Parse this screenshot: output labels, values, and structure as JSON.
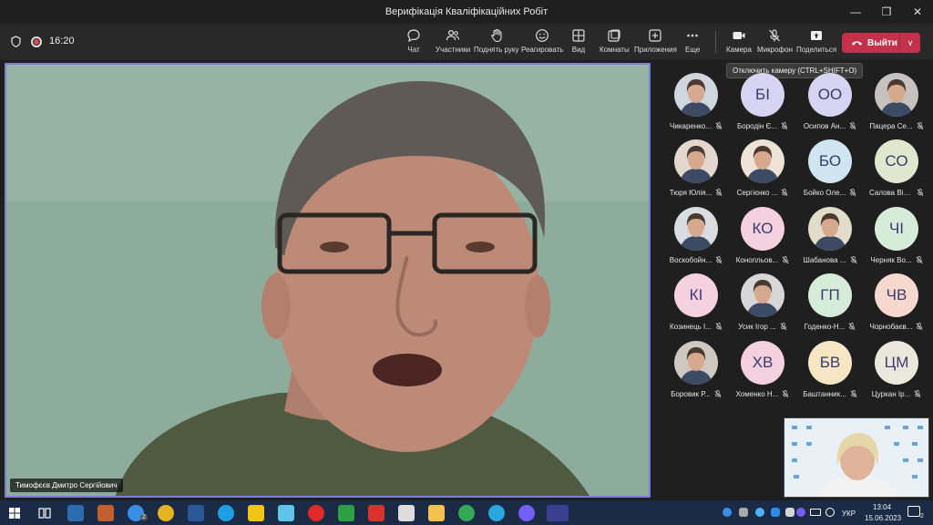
{
  "window": {
    "title": "Верифікація Кваліфікаційних Робіт"
  },
  "toolbar": {
    "timer": "16:20",
    "items": [
      {
        "label": "Чат",
        "icon": "chat-icon"
      },
      {
        "label": "Участники",
        "icon": "people-icon"
      },
      {
        "label": "Поднять руку",
        "icon": "raise-hand-icon"
      },
      {
        "label": "Реагировать",
        "icon": "smiley-icon"
      },
      {
        "label": "Вид",
        "icon": "grid-view-icon"
      },
      {
        "label": "Комнаты",
        "icon": "rooms-icon"
      },
      {
        "label": "Приложения",
        "icon": "plus-apps-icon"
      },
      {
        "label": "Еще",
        "icon": "more-icon"
      },
      {
        "label": "Камера",
        "icon": "camera-icon"
      },
      {
        "label": "Микрофон",
        "icon": "mic-off-icon"
      },
      {
        "label": "Поделиться",
        "icon": "share-icon"
      }
    ],
    "leave_label": "Выйти"
  },
  "tooltip": "Отключить камеру (CTRL+SHIFT+O)",
  "main_video": {
    "speaker_name": "Тимофєєв Дмитро Сергійович"
  },
  "participants": [
    {
      "name": "Чикаренко...",
      "initials": "",
      "photo": true,
      "bg": "#cfd6de"
    },
    {
      "name": "Бородін Є...",
      "initials": "БІ",
      "photo": false,
      "bg": "#d7d3f2"
    },
    {
      "name": "Осипов Ан...",
      "initials": "ОО",
      "photo": false,
      "bg": "#d7d3f2"
    },
    {
      "name": "Пацера Се...",
      "initials": "",
      "photo": true,
      "bg": "#c7c2bf"
    },
    {
      "name": "Тюря Юлія...",
      "initials": "",
      "photo": true,
      "bg": "#e4d7cf"
    },
    {
      "name": "Сергієнко ...",
      "initials": "",
      "photo": true,
      "bg": "#ede2d5"
    },
    {
      "name": "Бойко Оле...",
      "initials": "БО",
      "photo": false,
      "bg": "#cfe5f2"
    },
    {
      "name": "Салова Вір...",
      "initials": "СО",
      "photo": false,
      "bg": "#dfe8cf"
    },
    {
      "name": "Воскобойн...",
      "initials": "",
      "photo": true,
      "bg": "#d9dde2"
    },
    {
      "name": "Конопльов...",
      "initials": "КО",
      "photo": false,
      "bg": "#f5d0de"
    },
    {
      "name": "Шабанова ...",
      "initials": "",
      "photo": true,
      "bg": "#e3dccb"
    },
    {
      "name": "Черняк Во...",
      "initials": "ЧІ",
      "photo": false,
      "bg": "#d6ecd9"
    },
    {
      "name": "Козинець І...",
      "initials": "КІ",
      "photo": false,
      "bg": "#f5d0de"
    },
    {
      "name": "Усик Ігор ...",
      "initials": "",
      "photo": true,
      "bg": "#d7d7d7"
    },
    {
      "name": "Годенко-Н...",
      "initials": "ГП",
      "photo": false,
      "bg": "#d6ecd9"
    },
    {
      "name": "Чорнобаєв...",
      "initials": "ЧВ",
      "photo": false,
      "bg": "#f7d8cf"
    },
    {
      "name": "Боровик Р...",
      "initials": "",
      "photo": true,
      "bg": "#cfc8c0"
    },
    {
      "name": "Хоменко Н...",
      "initials": "ХВ",
      "photo": false,
      "bg": "#f5d0de"
    },
    {
      "name": "Баштанник...",
      "initials": "БВ",
      "photo": false,
      "bg": "#f7e6c4"
    },
    {
      "name": "Цуркан Ір...",
      "initials": "ЦМ",
      "photo": false,
      "bg": "#ece7dd"
    }
  ],
  "taskbar": {
    "badge_count": "2",
    "language": "УКР",
    "time": "13:04",
    "date": "15.06.2023",
    "notification_count": "2"
  }
}
